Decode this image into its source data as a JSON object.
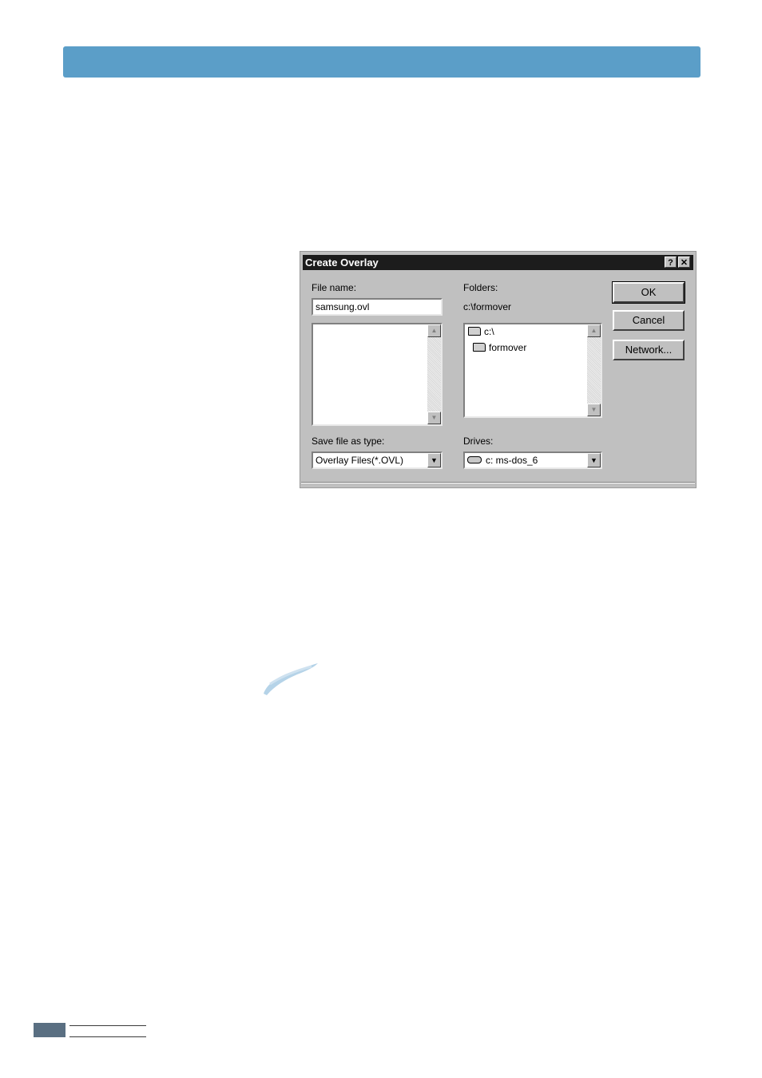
{
  "colors": {
    "header_bar": "#5b9ec8",
    "footer_block": "#5a6f82",
    "titlebar": "#1c1c1c",
    "dialog_face": "#c0c0c0"
  },
  "dialog": {
    "title": "Create Overlay",
    "help_glyph": "?",
    "close_glyph": "✕",
    "file_name_label": "File name:",
    "file_name_value": "samsung.ovl",
    "folders_label": "Folders:",
    "current_folder": "c:\\formover",
    "folders": [
      {
        "name": "c:\\",
        "icon": "open-folder-icon"
      },
      {
        "name": "formover",
        "icon": "open-folder-icon"
      }
    ],
    "save_type_label": "Save file as type:",
    "save_type_value": "Overlay Files(*.OVL)",
    "drives_label": "Drives:",
    "drive_value": "c: ms-dos_6",
    "buttons": {
      "ok": "OK",
      "cancel": "Cancel",
      "network": "Network..."
    }
  }
}
